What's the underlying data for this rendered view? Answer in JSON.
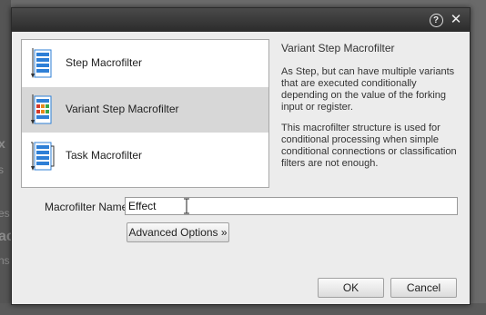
{
  "background": {
    "ghost_texts": [
      "x",
      "s",
      "es",
      "ac",
      "ns"
    ]
  },
  "dialog": {
    "help_icon_glyph": "?",
    "close_icon_glyph": "✕"
  },
  "macrofilter_types": [
    {
      "label": "Step Macrofilter",
      "icon": "step-macrofilter-icon",
      "selected": false
    },
    {
      "label": "Variant Step Macrofilter",
      "icon": "variant-step-macrofilter-icon",
      "selected": true
    },
    {
      "label": "Task Macrofilter",
      "icon": "task-macrofilter-icon",
      "selected": false
    }
  ],
  "description": {
    "title": "Variant Step Macrofilter",
    "paragraph1": "As Step, but can have multiple variants that are executed conditionally depending on the value of the forking input or register.",
    "paragraph2": "This macrofilter structure is used for conditional processing when simple conditional connections or classification filters are not enough."
  },
  "form": {
    "name_label": "Macrofilter Name:",
    "name_value": "Effect",
    "advanced_button": "Advanced Options »"
  },
  "buttons": {
    "ok": "OK",
    "cancel": "Cancel"
  },
  "colors": {
    "selected_row": "#d7d7d7",
    "titlebar": "#2b2b2b",
    "icon_blue": "#2e7fd6",
    "icon_orange": "#e8891c",
    "icon_green": "#3aa64a",
    "icon_red": "#d33a2c"
  }
}
